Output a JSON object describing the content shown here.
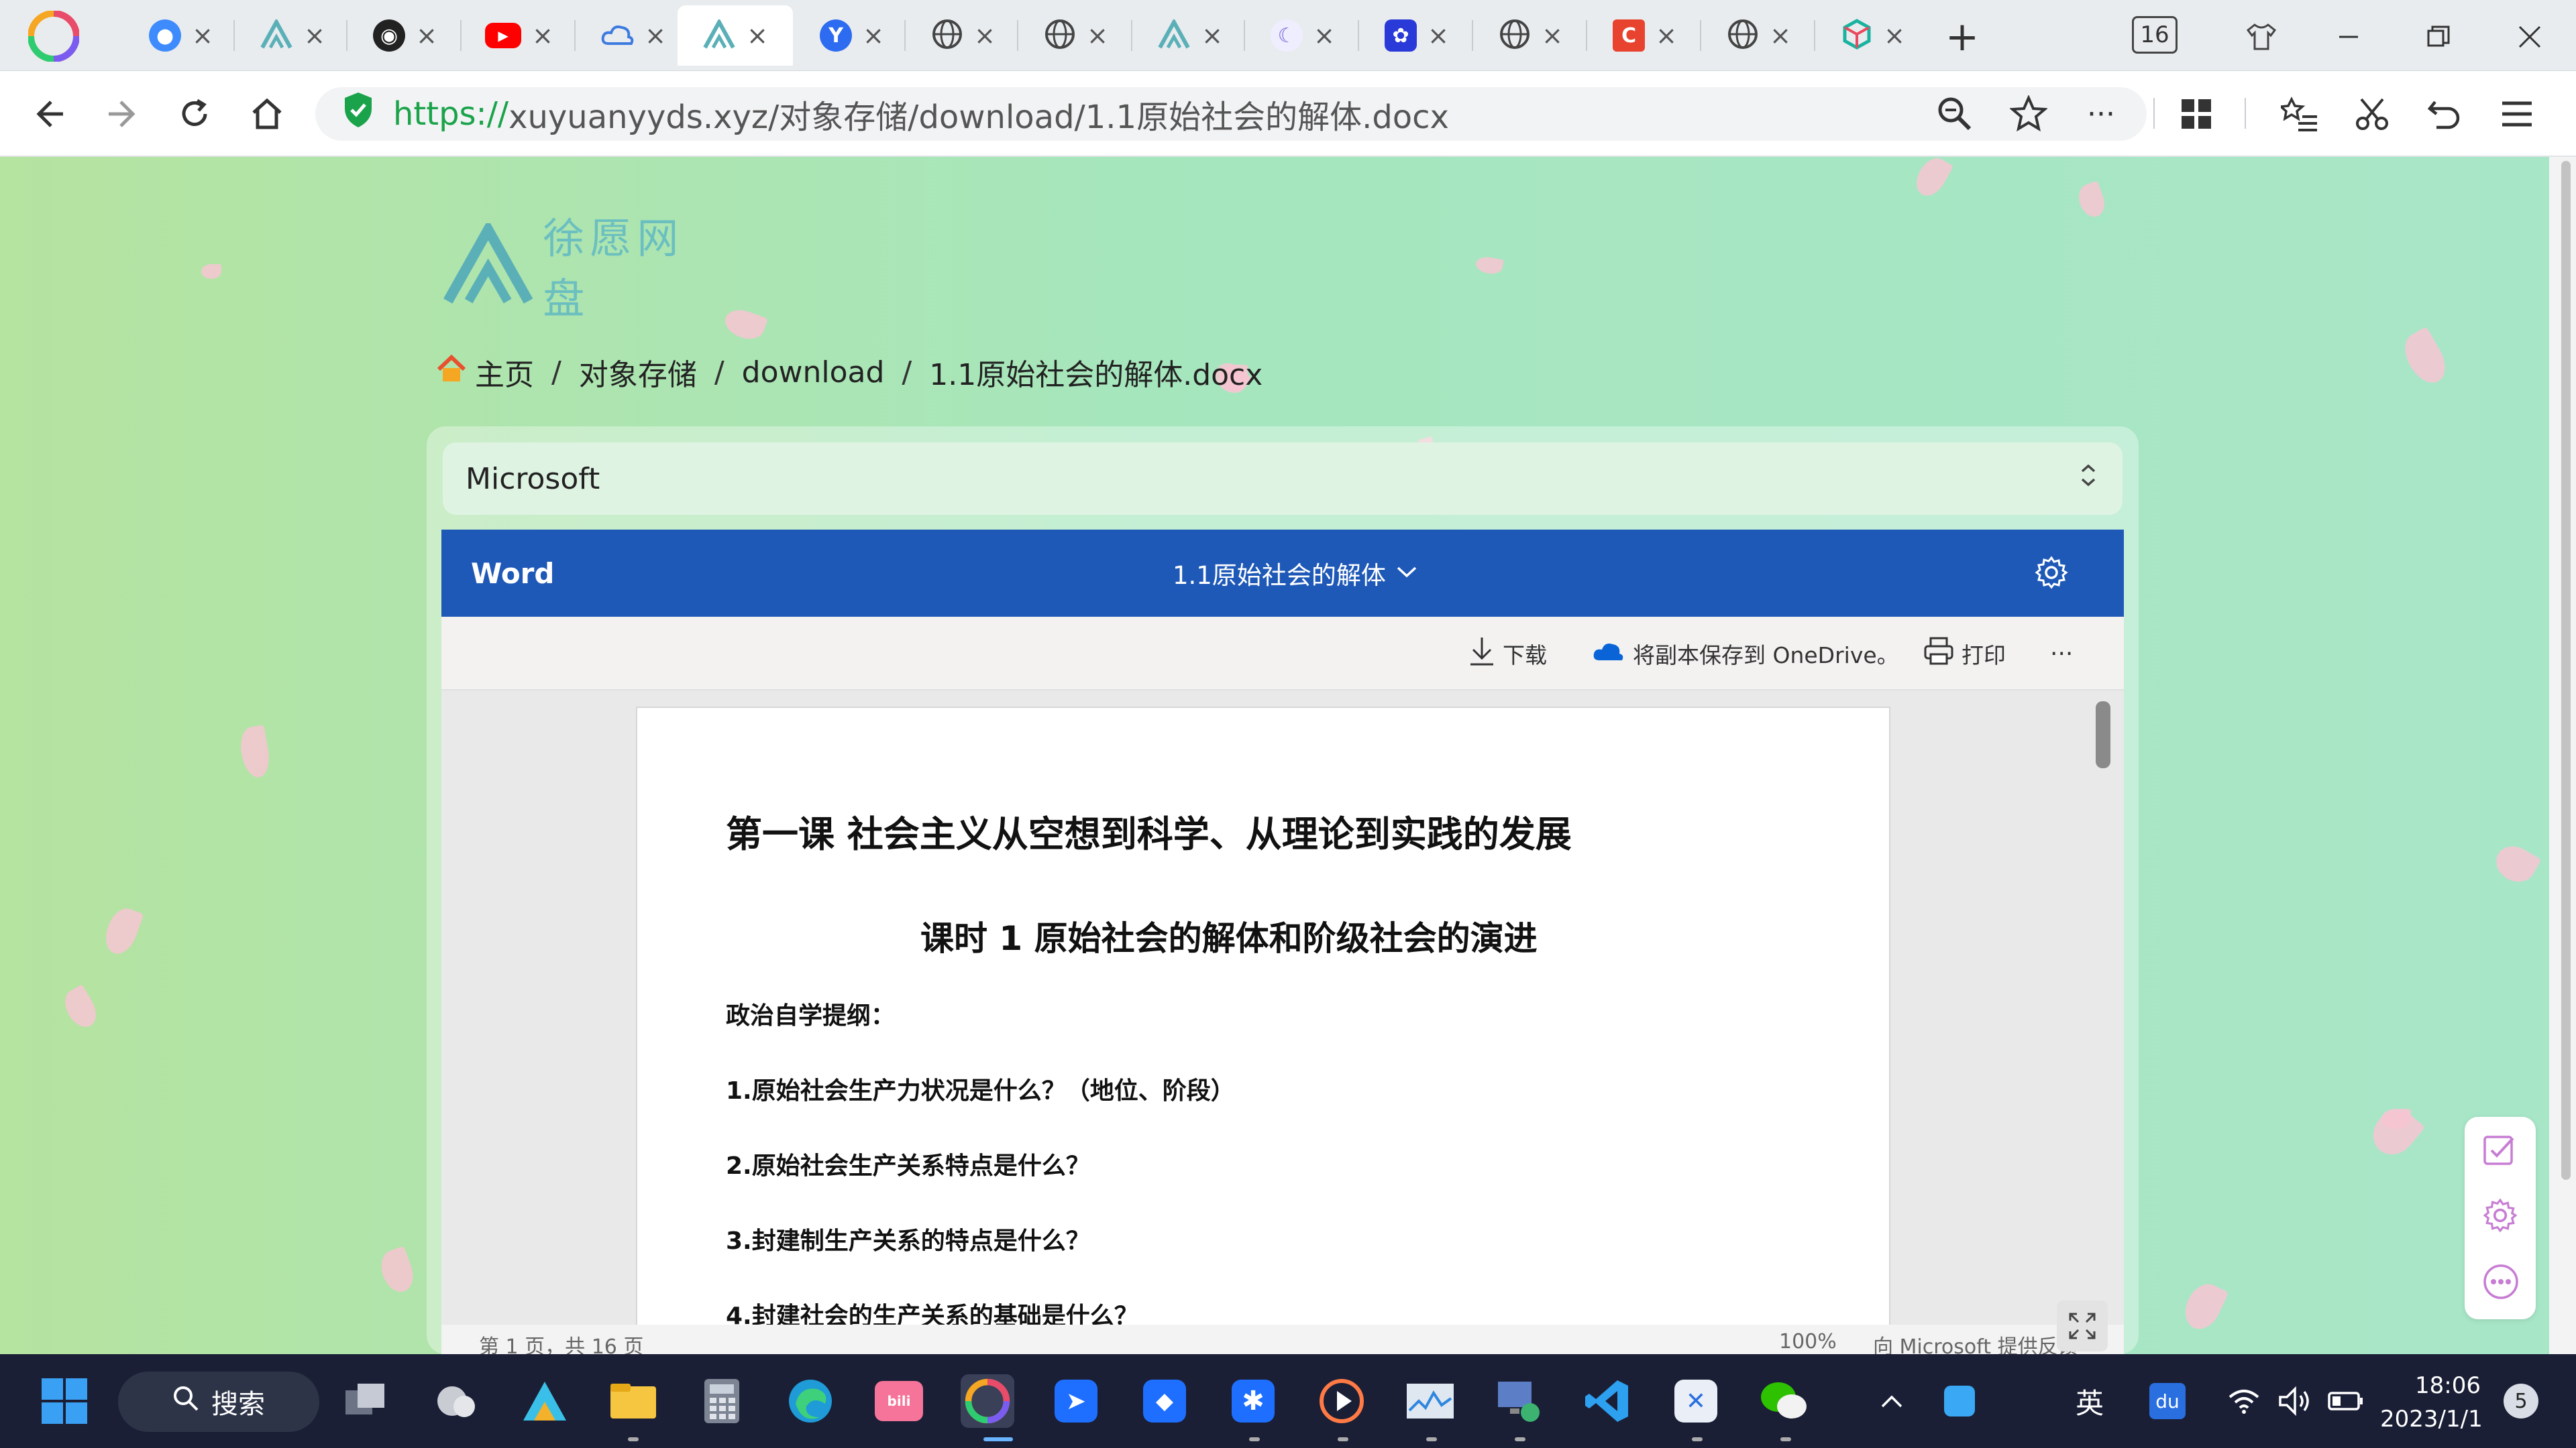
{
  "browser": {
    "tab_count": "16",
    "tabs": [
      {
        "icon": "globe-blue-icon",
        "active": false
      },
      {
        "icon": "xuyuan-logo-icon",
        "active": false
      },
      {
        "icon": "github-icon",
        "active": false
      },
      {
        "icon": "youtube-icon",
        "active": false
      },
      {
        "icon": "cloud-icon",
        "active": false
      },
      {
        "icon": "xuyuan-logo-icon",
        "active": true
      },
      {
        "icon": "y-blue-icon",
        "active": false
      },
      {
        "icon": "globe-icon",
        "active": false
      },
      {
        "icon": "globe-icon",
        "active": false
      },
      {
        "icon": "xuyuan-logo-icon",
        "active": false
      },
      {
        "icon": "moon-icon",
        "active": false
      },
      {
        "icon": "baidu-paw-icon",
        "active": false
      },
      {
        "icon": "globe-icon",
        "active": false
      },
      {
        "icon": "c-red-icon",
        "active": false
      },
      {
        "icon": "globe-icon",
        "active": false
      },
      {
        "icon": "cube-icon",
        "active": false
      }
    ],
    "url_scheme": "https://",
    "url_rest": "xuyuanyyds.xyz/对象存储/download/1.1原始社会的解体.docx"
  },
  "site": {
    "logo_text": "徐愿网盘",
    "breadcrumb": {
      "home": "主页",
      "sep": "/",
      "items": [
        "对象存储",
        "download",
        "1.1原始社会的解体.docx"
      ]
    },
    "viewer_select": "Microsoft"
  },
  "word": {
    "app_name": "Word",
    "doc_title": "1.1原始社会的解体",
    "download_label": "下载",
    "onedrive_label": "将副本保存到 OneDrive。",
    "print_label": "打印",
    "more_label": "···",
    "status_page": "第 1 页，共 16 页",
    "status_zoom": "100%",
    "status_feedback": "向 Microsoft 提供反馈",
    "document": {
      "h1": "第一课  社会主义从空想到科学、从理论到实践的发展",
      "h2": "课时 1    原始社会的解体和阶级社会的演进",
      "outline": "政治自学提纲：",
      "q1": "1.原始社会生产力状况是什么？（地位、阶段）",
      "q2": "2.原始社会生产关系特点是什么？",
      "q3": "3.封建制生产关系的特点是什么？",
      "q4": "4.封建社会的生产关系的基础是什么？"
    }
  },
  "taskbar": {
    "search_label": "搜索",
    "ime": "英",
    "time": "18:06",
    "date": "2023/1/1",
    "notification_count": "5"
  },
  "colors": {
    "word_blue": "#1f59b7",
    "secure_green": "#1aa34a",
    "taskbar_bg": "#1a1f36"
  }
}
